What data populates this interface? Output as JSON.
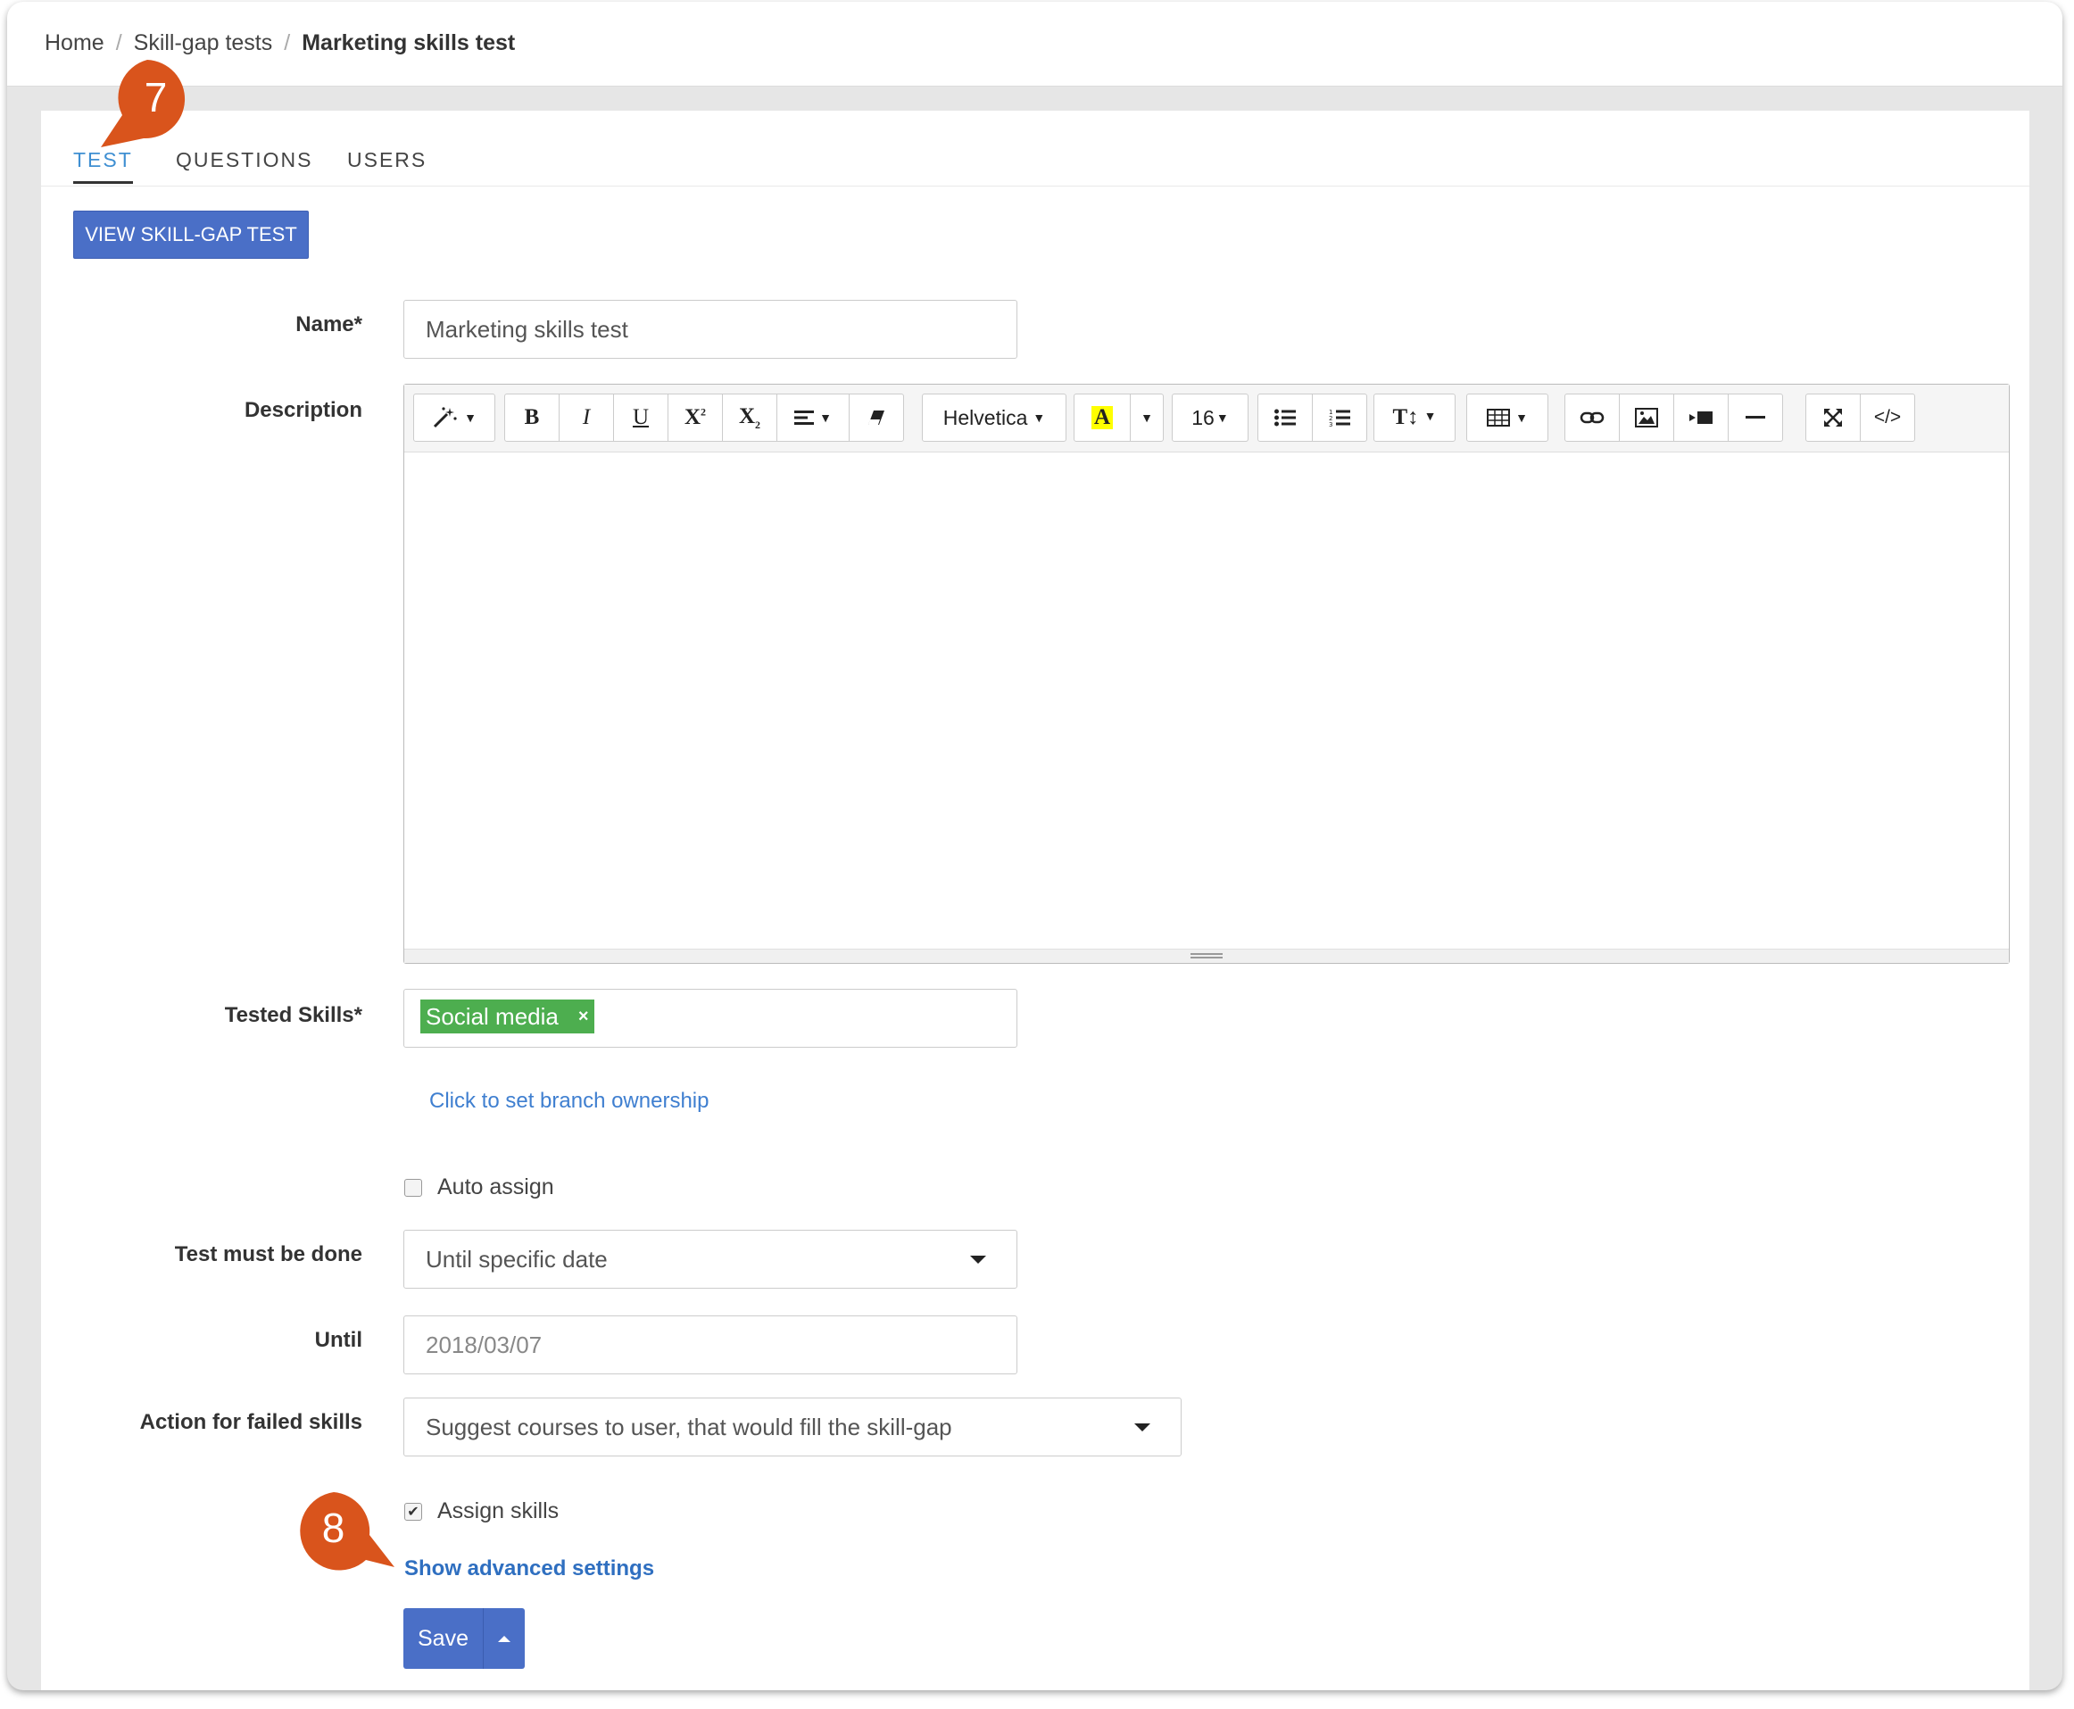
{
  "breadcrumb": {
    "home": "Home",
    "section": "Skill-gap tests",
    "current": "Marketing skills test"
  },
  "tabs": [
    {
      "label": "TEST",
      "active": true
    },
    {
      "label": "QUESTIONS",
      "active": false
    },
    {
      "label": "USERS",
      "active": false
    }
  ],
  "view_button": "VIEW SKILL-GAP TEST",
  "form": {
    "name_label": "Name*",
    "name_value": "Marketing skills test",
    "description_label": "Description",
    "toolbar": {
      "font_name": "Helvetica",
      "font_size": "16",
      "bold": "B",
      "italic": "I",
      "underline": "U",
      "code": "</>"
    },
    "skills_label": "Tested Skills*",
    "skill_tag": "Social media",
    "skill_remove": "×",
    "branch_link": "Click to set branch ownership",
    "auto_assign_label": "Auto assign",
    "auto_assign_checked": false,
    "must_be_done_label": "Test must be done",
    "must_be_done_value": "Until specific date",
    "until_label": "Until",
    "until_value": "2018/03/07",
    "failed_label": "Action for failed skills",
    "failed_value": "Suggest courses to user, that would fill the skill-gap",
    "assign_skills_label": "Assign skills",
    "assign_skills_checked": true,
    "advanced_link": "Show advanced settings",
    "save_label": "Save"
  },
  "callouts": [
    {
      "number": "7"
    },
    {
      "number": "8"
    }
  ],
  "colors": {
    "primary": "#4a6fc7",
    "tag_green": "#4dae4f",
    "callout_orange": "#d9541c",
    "active_tab": "#3f8fd2",
    "link": "#3f7fd0"
  }
}
